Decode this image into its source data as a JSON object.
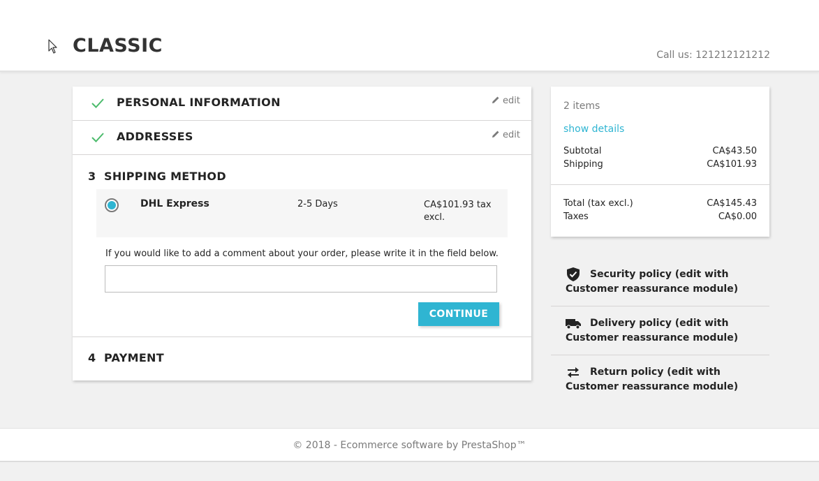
{
  "header": {
    "logo": "CLASSIC",
    "call_us": "Call us: 121212121212"
  },
  "steps": {
    "personal_info": {
      "title": "PERSONAL INFORMATION",
      "edit_label": "edit",
      "status": "complete"
    },
    "addresses": {
      "title": "ADDRESSES",
      "edit_label": "edit",
      "status": "complete"
    },
    "shipping": {
      "number": "3",
      "title": "SHIPPING METHOD",
      "carrier": {
        "name": "DHL Express",
        "delay": "2-5 Days",
        "price": "CA$101.93 tax excl.",
        "selected": true
      },
      "comment_label": "If you would like to add a comment about your order, please write it in the field below.",
      "comment_value": "",
      "continue_label": "CONTINUE"
    },
    "payment": {
      "number": "4",
      "title": "PAYMENT"
    }
  },
  "summary": {
    "items_count": "2 items",
    "show_details": "show details",
    "subtotal_label": "Subtotal",
    "subtotal_value": "CA$43.50",
    "shipping_label": "Shipping",
    "shipping_value": "CA$101.93",
    "total_label": "Total (tax excl.)",
    "total_value": "CA$145.43",
    "taxes_label": "Taxes",
    "taxes_value": "CA$0.00"
  },
  "reassurance": [
    {
      "icon": "shield-icon",
      "text": "Security policy (edit with Customer reassurance module)"
    },
    {
      "icon": "truck-icon",
      "text": "Delivery policy (edit with Customer reassurance module)"
    },
    {
      "icon": "arrows-exchange-icon",
      "text": "Return policy (edit with Customer reassurance module)"
    }
  ],
  "footer": {
    "copyright": "© 2018 - Ecommerce software by PrestaShop™"
  },
  "colors": {
    "accent": "#2fb5d2",
    "check": "#4cbb6c",
    "background": "#f1f1f1",
    "text": "#232323",
    "muted": "#7a7a7a"
  }
}
